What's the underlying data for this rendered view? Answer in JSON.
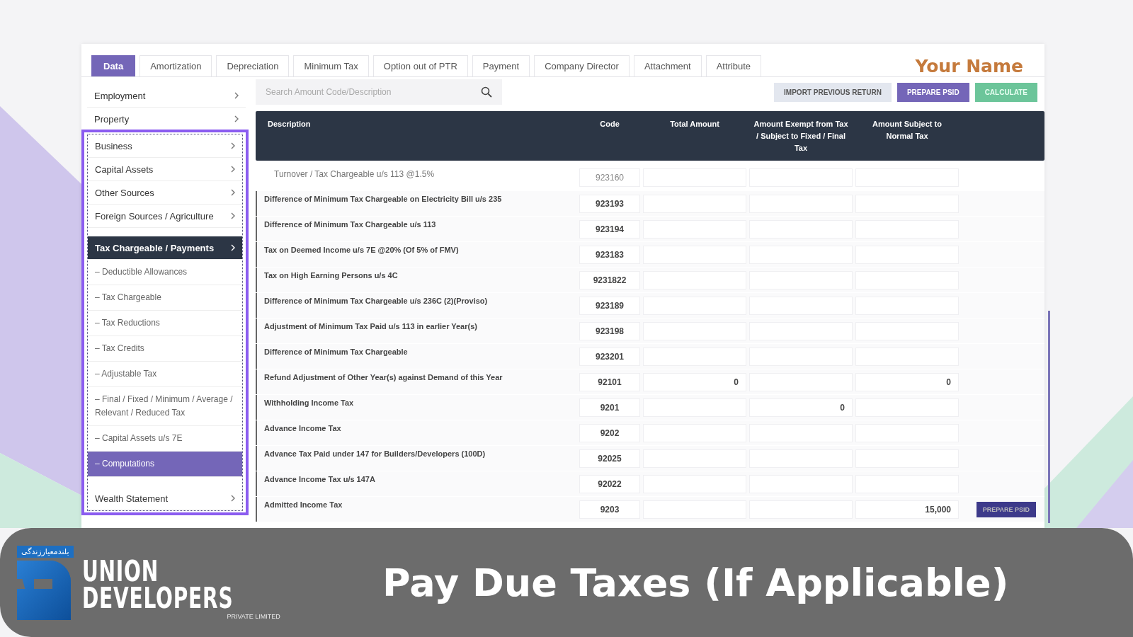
{
  "tabs": [
    {
      "label": "Data",
      "selected": true
    },
    {
      "label": "Amortization",
      "selected": false
    },
    {
      "label": "Depreciation",
      "selected": false
    },
    {
      "label": "Minimum Tax",
      "selected": false
    },
    {
      "label": "Option out of PTR",
      "selected": false
    },
    {
      "label": "Payment",
      "selected": false
    },
    {
      "label": "Company Director",
      "selected": false
    },
    {
      "label": "Attachment",
      "selected": false
    },
    {
      "label": "Attribute",
      "selected": false
    }
  ],
  "user_name": "Your Name",
  "sidebar": {
    "items": [
      {
        "label": "Employment",
        "selected": false,
        "expanded": false
      },
      {
        "label": "Property",
        "selected": false,
        "expanded": false
      }
    ],
    "highlight_box": {
      "items": [
        {
          "label": "Business",
          "selected": false,
          "expanded": false
        },
        {
          "label": "Capital Assets",
          "selected": false,
          "expanded": false
        },
        {
          "label": "Other Sources",
          "selected": false,
          "expanded": false
        },
        {
          "label": "Foreign Sources / Agriculture",
          "selected": false,
          "expanded": false
        },
        {
          "label": "Tax Chargeable / Payments",
          "selected": false,
          "expanded": true,
          "children": [
            {
              "label": "– Deductible Allowances",
              "selected": false
            },
            {
              "label": "– Tax Chargeable",
              "selected": false
            },
            {
              "label": "– Tax Reductions",
              "selected": false
            },
            {
              "label": "– Tax Credits",
              "selected": false
            },
            {
              "label": "– Adjustable Tax",
              "selected": false
            },
            {
              "label": "– Final / Fixed / Minimum / Average / Relevant / Reduced Tax",
              "selected": false
            },
            {
              "label": "– Capital Assets u/s 7E",
              "selected": false
            },
            {
              "label": "– Computations",
              "selected": true
            }
          ]
        },
        {
          "label": "Wealth Statement",
          "selected": false,
          "expanded": false
        }
      ]
    }
  },
  "search": {
    "placeholder": "Search Amount Code/Description"
  },
  "buttons": [
    {
      "label": "IMPORT PREVIOUS RETURN",
      "kind": "secondary"
    },
    {
      "label": "PREPARE PSID",
      "kind": "primary"
    },
    {
      "label": "CALCULATE",
      "kind": "success"
    }
  ],
  "table": {
    "columns": [
      "Description",
      "Code",
      "Total Amount",
      "Amount Exempt from Tax / Subject to Fixed / Final Tax",
      "Amount Subject to Normal Tax"
    ],
    "rows": [
      {
        "kind": "sub",
        "description": "Turnover / Tax Chargeable u/s 113 @1.5%",
        "code": "923160"
      },
      {
        "kind": "main",
        "description": "Difference of Minimum Tax Chargeable on Electricity Bill u/s 235",
        "code": "923193"
      },
      {
        "kind": "main",
        "description": "Difference of Minimum Tax Chargeable u/s 113",
        "code": "923194"
      },
      {
        "kind": "main",
        "description": "Tax on Deemed Income u/s 7E @20% (Of 5% of FMV)",
        "code": "923183"
      },
      {
        "kind": "main",
        "description": "Tax on High Earning Persons u/s 4C",
        "code": "9231822"
      },
      {
        "kind": "main",
        "description": "Difference of Minimum Tax Chargeable u/s 236C (2)(Proviso)",
        "code": "923189"
      },
      {
        "kind": "main",
        "description": "Adjustment of Minimum Tax Paid u/s 113 in earlier Year(s)",
        "code": "923198"
      },
      {
        "kind": "main",
        "description": "Difference of Minimum Tax Chargeable",
        "code": "923201"
      },
      {
        "kind": "main",
        "description": "Refund Adjustment of Other Year(s) against Demand of this Year",
        "code": "92101",
        "total": "0",
        "subject": "0"
      },
      {
        "kind": "main",
        "description": "Withholding Income Tax",
        "code": "9201",
        "exempt": "0"
      },
      {
        "kind": "main",
        "description": "Advance Income Tax",
        "code": "9202"
      },
      {
        "kind": "main",
        "description": "Advance Tax Paid under 147 for Builders/Developers (100D)",
        "code": "92025"
      },
      {
        "kind": "main",
        "description": "Advance Income Tax u/s 147A",
        "code": "92022"
      },
      {
        "kind": "main",
        "description": "Admitted Income Tax",
        "code": "9203",
        "subject": "15,000",
        "action": "PREPARE PSID"
      }
    ]
  },
  "banner": {
    "tagline": "بلندمعیارزندگی",
    "brand_line_1": "UNION",
    "brand_line_2": "DEVELOPERS",
    "brand_sub": "PRIVATE LIMITED",
    "title": "Pay Due Taxes (If Applicable)"
  }
}
